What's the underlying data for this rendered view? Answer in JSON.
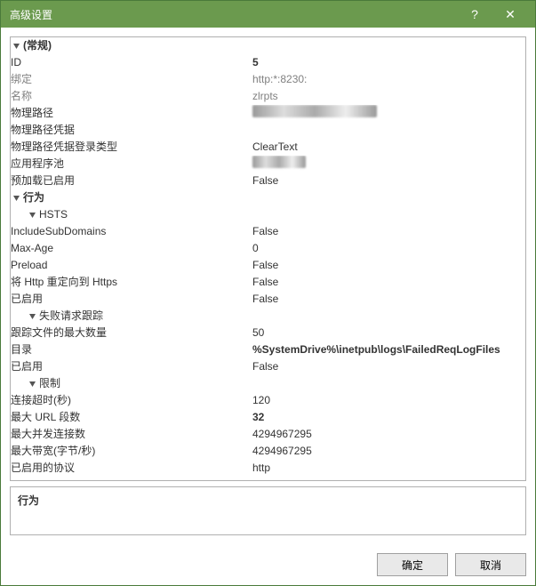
{
  "titlebar": {
    "title": "高级设置",
    "help_glyph": "?",
    "close_glyph": "✕"
  },
  "categories": {
    "general": "(常规)",
    "behavior": "行为",
    "hsts": "HSTS",
    "failed_req": "失败请求跟踪",
    "limits": "限制"
  },
  "props": {
    "id": {
      "label": "ID",
      "value": "5"
    },
    "bindings": {
      "label": "绑定",
      "value": "http:*:8230:"
    },
    "name": {
      "label": "名称",
      "value": "zlrpts"
    },
    "physical_path": {
      "label": "物理路径"
    },
    "physical_path_creds": {
      "label": "物理路径凭据",
      "value": ""
    },
    "physical_path_login": {
      "label": "物理路径凭据登录类型",
      "value": "ClearText"
    },
    "app_pool": {
      "label": "应用程序池"
    },
    "preload": {
      "label": "预加载已启用",
      "value": "False"
    },
    "hsts_sub": {
      "label": "IncludeSubDomains",
      "value": "False"
    },
    "hsts_maxage": {
      "label": "Max-Age",
      "value": "0"
    },
    "hsts_preload": {
      "label": "Preload",
      "value": "False"
    },
    "hsts_redirect": {
      "label": "将 Http 重定向到 Https",
      "value": "False"
    },
    "hsts_enabled": {
      "label": "已启用",
      "value": "False"
    },
    "fr_maxfiles": {
      "label": "跟踪文件的最大数量",
      "value": "50"
    },
    "fr_dir": {
      "label": "目录",
      "value": "%SystemDrive%\\inetpub\\logs\\FailedReqLogFiles"
    },
    "fr_enabled": {
      "label": "已启用",
      "value": "False"
    },
    "lim_timeout": {
      "label": "连接超时(秒)",
      "value": "120"
    },
    "lim_urlseg": {
      "label": "最大 URL 段数",
      "value": "32"
    },
    "lim_maxconn": {
      "label": "最大并发连接数",
      "value": "4294967295"
    },
    "lim_bandwidth": {
      "label": "最大带宽(字节/秒)",
      "value": "4294967295"
    },
    "protocols": {
      "label": "已启用的协议",
      "value": "http"
    }
  },
  "description": {
    "title": "行为"
  },
  "footer": {
    "ok": "确定",
    "cancel": "取消"
  }
}
